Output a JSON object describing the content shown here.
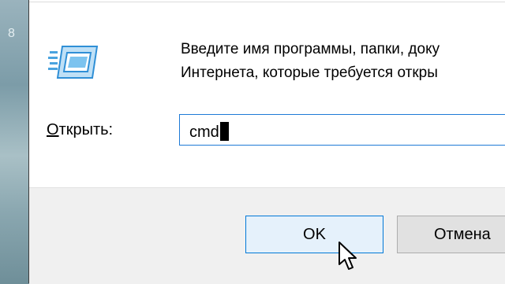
{
  "desktop": {
    "partial_text": "8"
  },
  "dialog": {
    "description_line1": "Введите имя программы, папки, доку",
    "description_line2": "Интернета, которые требуется откры",
    "open_label_accel": "О",
    "open_label_rest": "ткрыть:",
    "command_value": "cmd",
    "ok_label": "OK",
    "cancel_label": "Отмена"
  },
  "icons": {
    "app": "run-dialog-icon",
    "pointer": "mouse-pointer-icon"
  },
  "colors": {
    "input_border": "#1e7ad6",
    "ok_border": "#0078d7",
    "ok_background": "#e5f1fb",
    "footer_background": "#f0f0f0"
  }
}
